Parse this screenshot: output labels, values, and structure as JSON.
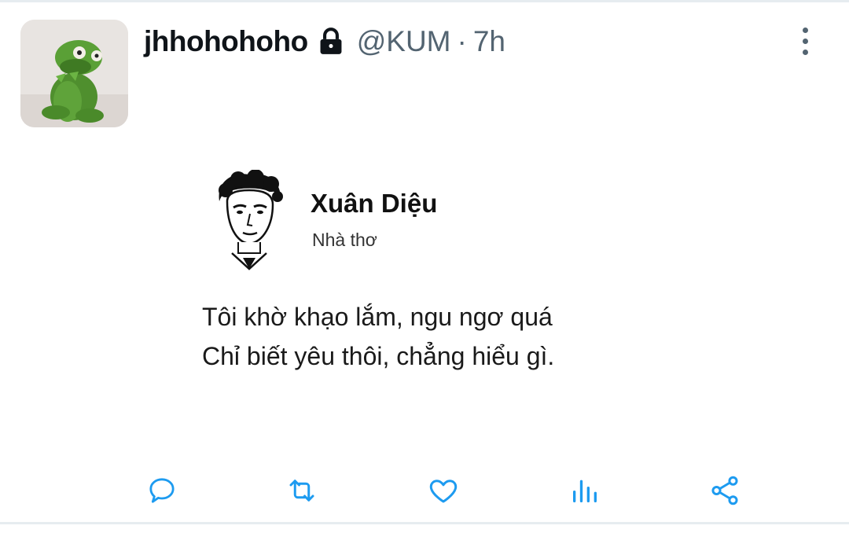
{
  "tweet": {
    "display_name": "jhhohohoho",
    "handle": "@KUM",
    "separator": "·",
    "time": "7h",
    "protected": true
  },
  "quote_card": {
    "author": "Xuân Diệu",
    "role": "Nhà thơ",
    "lines": [
      "Tôi khờ khạo lắm, ngu ngơ quá",
      "Chỉ biết yêu thôi, chẳng hiểu gì."
    ]
  },
  "actions": [
    "reply",
    "retweet",
    "like",
    "analytics",
    "share"
  ],
  "icons": {
    "lock": "lock-icon",
    "more": "more-vertical-icon",
    "reply": "reply-icon",
    "retweet": "retweet-icon",
    "like": "heart-icon",
    "analytics": "analytics-icon",
    "share": "share-icon"
  },
  "colors": {
    "text_primary": "#0f1419",
    "text_secondary": "#536471",
    "icon_accent": "#1d9bf0",
    "divider": "#e6ecf0"
  }
}
